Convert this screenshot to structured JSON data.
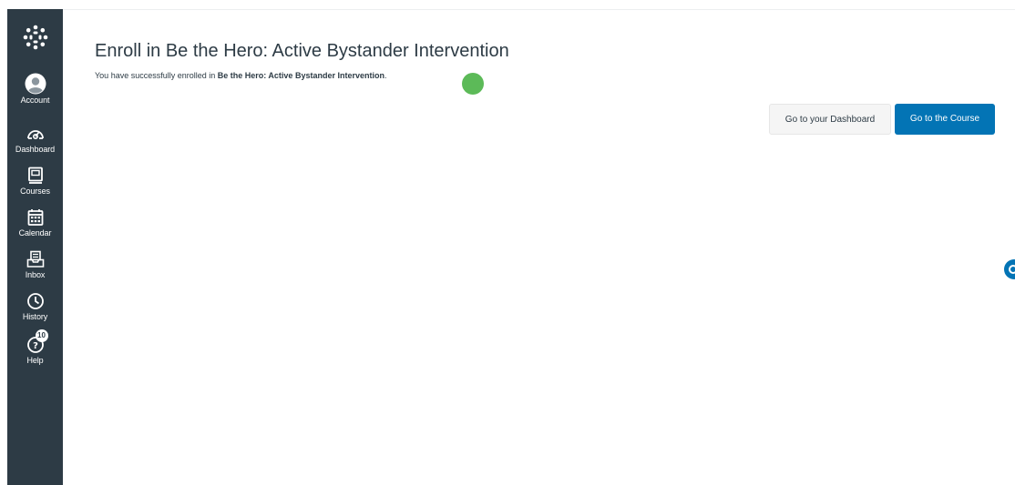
{
  "nav": {
    "items": [
      {
        "id": "account",
        "label": "Account",
        "icon": "account-icon"
      },
      {
        "id": "dashboard",
        "label": "Dashboard",
        "icon": "dashboard-icon"
      },
      {
        "id": "courses",
        "label": "Courses",
        "icon": "courses-icon"
      },
      {
        "id": "calendar",
        "label": "Calendar",
        "icon": "calendar-icon"
      },
      {
        "id": "inbox",
        "label": "Inbox",
        "icon": "inbox-icon"
      },
      {
        "id": "history",
        "label": "History",
        "icon": "history-icon"
      },
      {
        "id": "help",
        "label": "Help",
        "icon": "help-icon",
        "badge": "10"
      }
    ],
    "background": "#2d3b45"
  },
  "main": {
    "title": "Enroll in Be the Hero: Active Bystander Intervention",
    "message_prefix": "You have successfully enrolled in ",
    "message_course": "Be the Hero: Active Bystander Intervention",
    "message_suffix": ".",
    "buttons": {
      "dashboard": "Go to your Dashboard",
      "course": "Go to the Course"
    }
  },
  "colors": {
    "primary": "#0374b5",
    "success_dot": "#5cba58",
    "text": "#2d3b45"
  }
}
